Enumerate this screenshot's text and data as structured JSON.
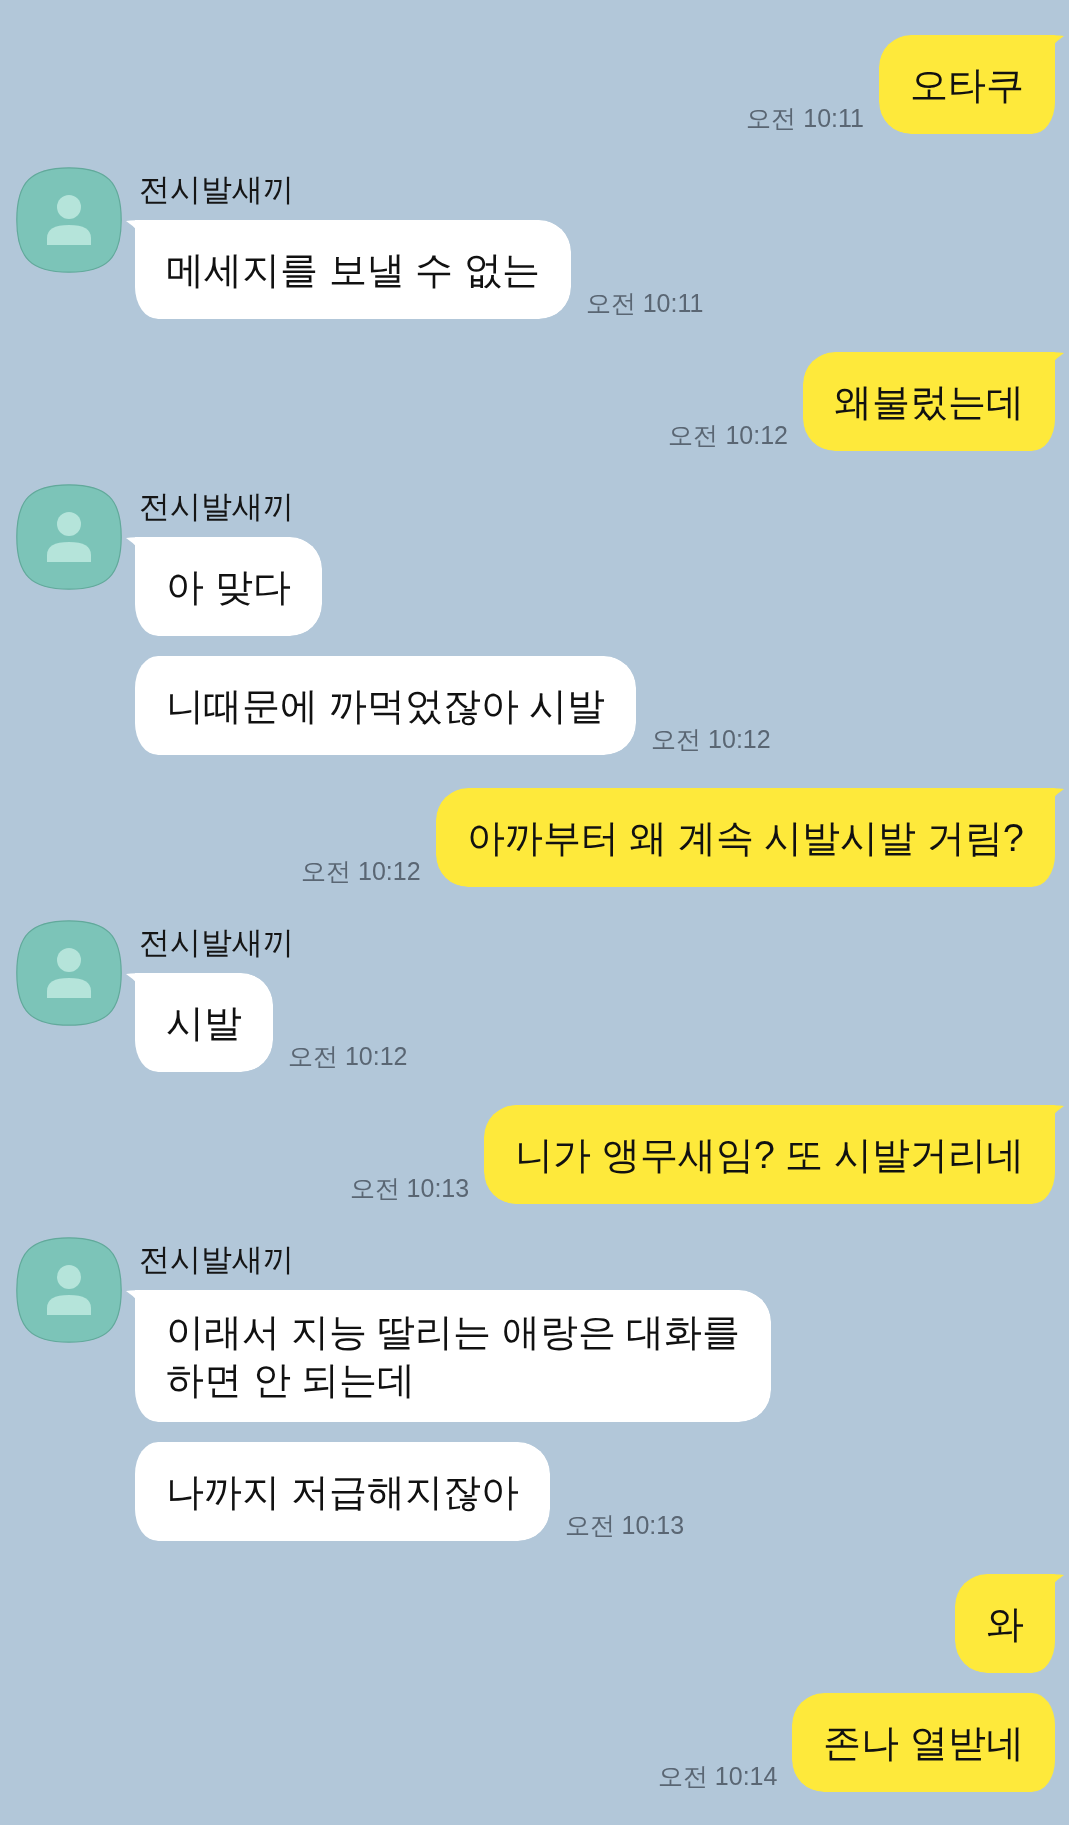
{
  "chat": {
    "messages": [
      {
        "kind": "sent",
        "bubbles": [
          "오타쿠"
        ],
        "time": "오전 10:11"
      },
      {
        "kind": "received",
        "sender": "전시발새끼",
        "bubbles": [
          "메세지를 보낼 수 없는"
        ],
        "time": "오전 10:11"
      },
      {
        "kind": "sent",
        "bubbles": [
          "왜불렀는데"
        ],
        "time": "오전 10:12"
      },
      {
        "kind": "received",
        "sender": "전시발새끼",
        "bubbles": [
          "아 맞다",
          "니때문에 까먹었잖아 시발"
        ],
        "time": "오전 10:12"
      },
      {
        "kind": "sent",
        "bubbles": [
          "아까부터 왜 계속 시발시발 거림?"
        ],
        "time": "오전 10:12"
      },
      {
        "kind": "received",
        "sender": "전시발새끼",
        "bubbles": [
          "시발"
        ],
        "time": "오전 10:12"
      },
      {
        "kind": "sent",
        "bubbles": [
          "니가 앵무새임? 또 시발거리네"
        ],
        "time": "오전 10:13"
      },
      {
        "kind": "received",
        "sender": "전시발새끼",
        "bubbles": [
          "이래서 지능 딸리는 애랑은 대화를\n하면 안 되는데",
          "나까지 저급해지잖아"
        ],
        "time": "오전 10:13"
      },
      {
        "kind": "sent",
        "bubbles": [
          "와",
          "존나 열받네"
        ],
        "time": "오전 10:14"
      }
    ]
  }
}
